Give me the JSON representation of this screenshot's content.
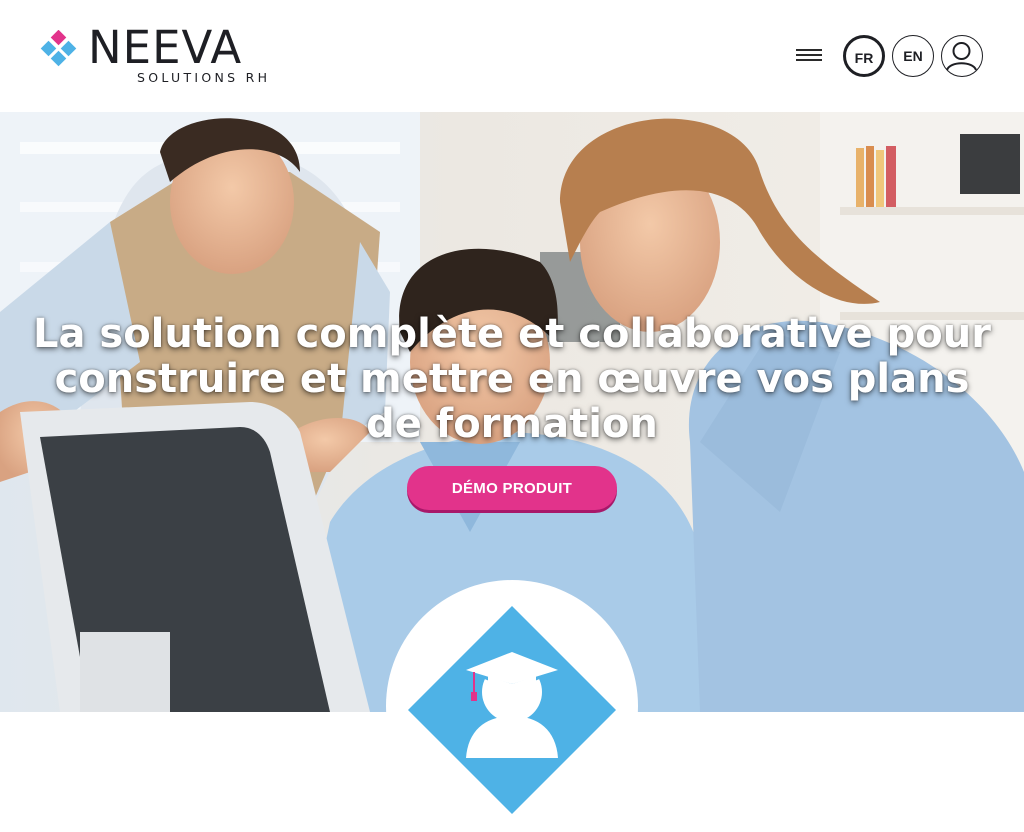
{
  "header": {
    "logo": {
      "name": "NEEVA",
      "tagline": "SOLUTIONS RH"
    },
    "languages": [
      {
        "code": "FR",
        "active": true
      },
      {
        "code": "EN",
        "active": false
      }
    ],
    "menu_icon": "hamburger-icon",
    "user_icon": "user-icon"
  },
  "hero": {
    "title": "La solution complète et collaborative pour construire et mettre en œuvre vos plans de formation",
    "cta_label": "DÉMO PRODUIT"
  },
  "feature": {
    "icon": "graduation-cap-icon"
  },
  "colors": {
    "brand_pink": "#e2338b",
    "brand_blue": "#4eb2e6",
    "text_dark": "#1e1f24"
  }
}
